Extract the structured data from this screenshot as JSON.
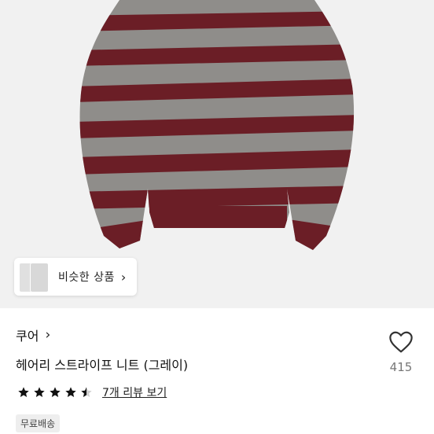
{
  "similar_products": {
    "label": "비슷한 상품",
    "chevron_icon": "chevron-right-icon"
  },
  "product": {
    "brand": "쿠어",
    "title": "헤어리 스트라이프 니트 (그레이)",
    "like_count": "415",
    "rating": 4.5,
    "review_link": "7개 리뷰 보기",
    "shipping_badge": "무료배송"
  },
  "colors": {
    "knit_gray": "#8f8d8a",
    "stripe_burgundy": "#6b1e26",
    "background": "#f1f1f1"
  }
}
